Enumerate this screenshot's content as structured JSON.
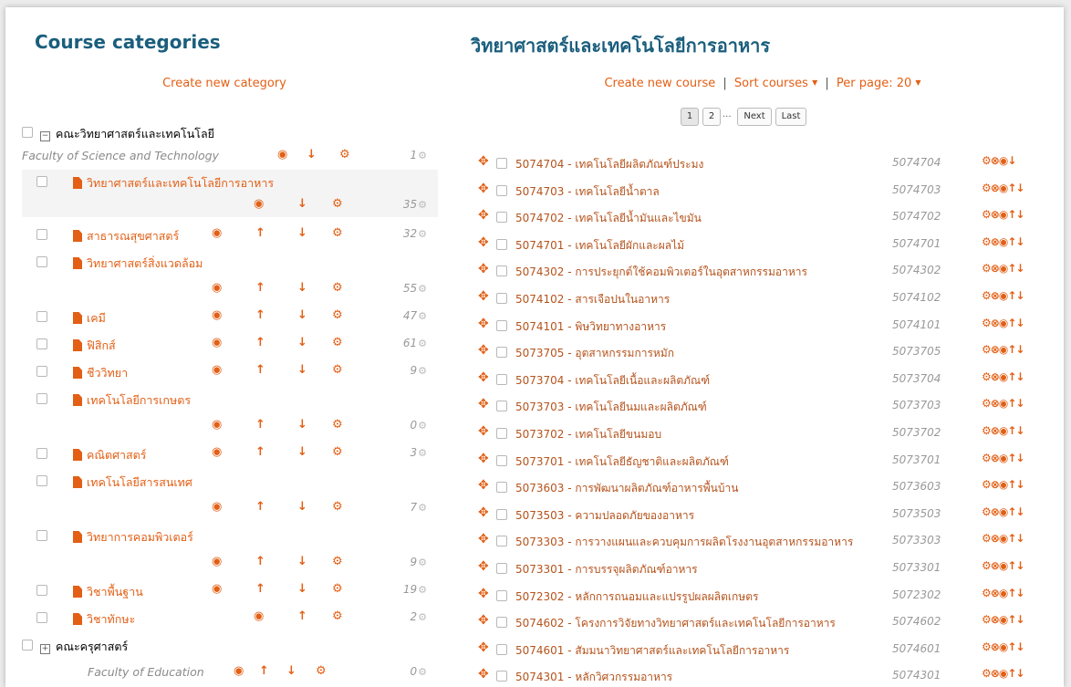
{
  "left": {
    "title": "Course categories",
    "create_label": "Create new category",
    "top_category": {
      "name": "คณะวิทยาศาสตร์และเทคโนโลยี",
      "english": "Faculty of Science and Technology",
      "count": "1"
    },
    "categories": [
      {
        "name": "วิทยาศาสตร์และเทคโนโลยีการอาหาร",
        "count": "35"
      },
      {
        "name": "สาธารณสุขศาสตร์",
        "count": "32"
      },
      {
        "name": "วิทยาศาสตร์สิ่งแวดล้อม",
        "count": "55"
      },
      {
        "name": "เคมี",
        "count": "47"
      },
      {
        "name": "ฟิสิกส์",
        "count": "61"
      },
      {
        "name": "ชีววิทยา",
        "count": "9"
      },
      {
        "name": "เทคโนโลยีการเกษตร",
        "count": "0"
      },
      {
        "name": "คณิตศาสตร์",
        "count": "3"
      },
      {
        "name": "เทคโนโลยีสารสนเทศ",
        "count": "7"
      },
      {
        "name": "วิทยาการคอมพิวเตอร์",
        "count": "9"
      },
      {
        "name": "วิชาพื้นฐาน",
        "count": "19"
      },
      {
        "name": "วิชาทักษะ",
        "count": "2"
      }
    ],
    "bottom_category": {
      "name": "คณะครุศาสตร์",
      "english": "Faculty of Education",
      "count": "0"
    }
  },
  "right": {
    "title": "วิทยาศาสตร์และเทคโนโลยีการอาหาร",
    "create_course": "Create new course",
    "sort_courses": "Sort courses",
    "per_page": "Per page: 20",
    "separator": "|",
    "pager": {
      "p1": "1",
      "p2": "2",
      "ellipsis": "...",
      "next": "Next",
      "last": "Last"
    },
    "courses": [
      {
        "name": "5074704 - เทคโนโลยีผลิตภัณฑ์ประมง",
        "id": "5074704"
      },
      {
        "name": "5074703 - เทคโนโลยีน้ำตาล",
        "id": "5074703"
      },
      {
        "name": "5074702 - เทคโนโลยีน้ำมันและไขมัน",
        "id": "5074702"
      },
      {
        "name": "5074701 - เทคโนโลยีผักและผลไม้",
        "id": "5074701"
      },
      {
        "name": "5074302 - การประยุกต์ใช้คอมพิวเตอร์ในอุตสาหกรรมอาหาร",
        "id": "5074302"
      },
      {
        "name": "5074102 - สารเจือปนในอาหาร",
        "id": "5074102"
      },
      {
        "name": "5074101 - พิษวิทยาทางอาหาร",
        "id": "5074101"
      },
      {
        "name": "5073705 - อุตสาหกรรมการหมัก",
        "id": "5073705"
      },
      {
        "name": "5073704 - เทคโนโลยีเนื้อและผลิตภัณฑ์",
        "id": "5073704"
      },
      {
        "name": "5073703 - เทคโนโลยีนมและผลิตภัณฑ์",
        "id": "5073703"
      },
      {
        "name": "5073702 - เทคโนโลยีขนมอบ",
        "id": "5073702"
      },
      {
        "name": "5073701 - เทคโนโลยีธัญชาติและผลิตภัณฑ์",
        "id": "5073701"
      },
      {
        "name": "5073603 - การพัฒนาผลิตภัณฑ์อาหารพื้นบ้าน",
        "id": "5073603"
      },
      {
        "name": "5073503 - ความปลอดภัยของอาหาร",
        "id": "5073503"
      },
      {
        "name": "5073303 - การวางแผนและควบคุมการผลิตโรงงานอุตสาหกรรมอาหาร",
        "id": "5073303"
      },
      {
        "name": "5073301 - การบรรจุผลิตภัณฑ์อาหาร",
        "id": "5073301"
      },
      {
        "name": "5072302 - หลักการถนอมและแปรรูปผลผลิตเกษตร",
        "id": "5072302"
      },
      {
        "name": "5074602 - โครงการวิจัยทางวิทยาศาสตร์และเทคโนโลยีการอาหาร",
        "id": "5074602"
      },
      {
        "name": "5074601 - สัมมนาวิทยาศาสตร์และเทคโนโลยีการอาหาร",
        "id": "5074601"
      },
      {
        "name": "5074301 - หลักวิศวกรรมอาหาร",
        "id": "5074301"
      }
    ]
  },
  "icons": {
    "eye": "eye-icon",
    "up": "arrow-up-icon",
    "down": "arrow-down-icon",
    "cogs": "cogs-icon",
    "move": "move-icon",
    "delete": "delete-icon",
    "file": "file-icon"
  },
  "colors": {
    "heading": "#1a5e7d",
    "accent": "#e25f15",
    "link": "#b5531c"
  }
}
